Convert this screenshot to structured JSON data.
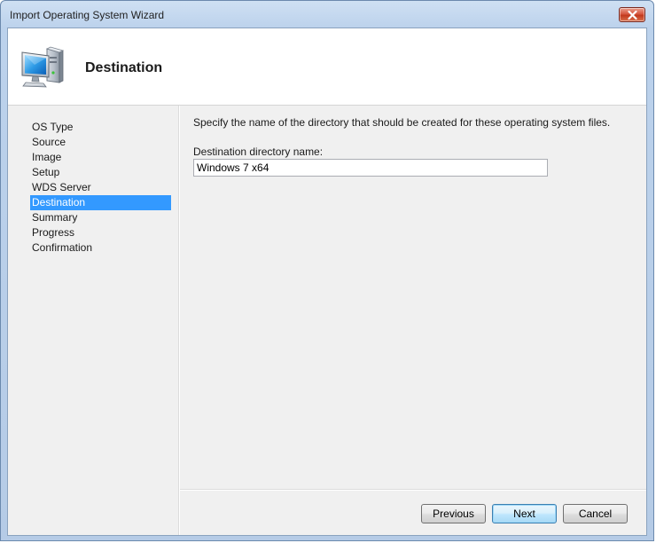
{
  "window": {
    "title": "Import Operating System Wizard"
  },
  "header": {
    "title": "Destination",
    "icon": "computer-icon"
  },
  "nav": {
    "items": [
      {
        "label": "OS Type"
      },
      {
        "label": "Source"
      },
      {
        "label": "Image"
      },
      {
        "label": "Setup"
      },
      {
        "label": "WDS Server"
      },
      {
        "label": "Destination",
        "selected": true
      },
      {
        "label": "Summary"
      },
      {
        "label": "Progress"
      },
      {
        "label": "Confirmation"
      }
    ],
    "selected_color": "#3399ff"
  },
  "content": {
    "instruction": "Specify the name of the directory that should be created for these operating system files.",
    "field_label": "Destination directory name:",
    "field_value": "Windows 7 x64"
  },
  "buttons": {
    "previous": "Previous",
    "next": "Next",
    "cancel": "Cancel"
  }
}
